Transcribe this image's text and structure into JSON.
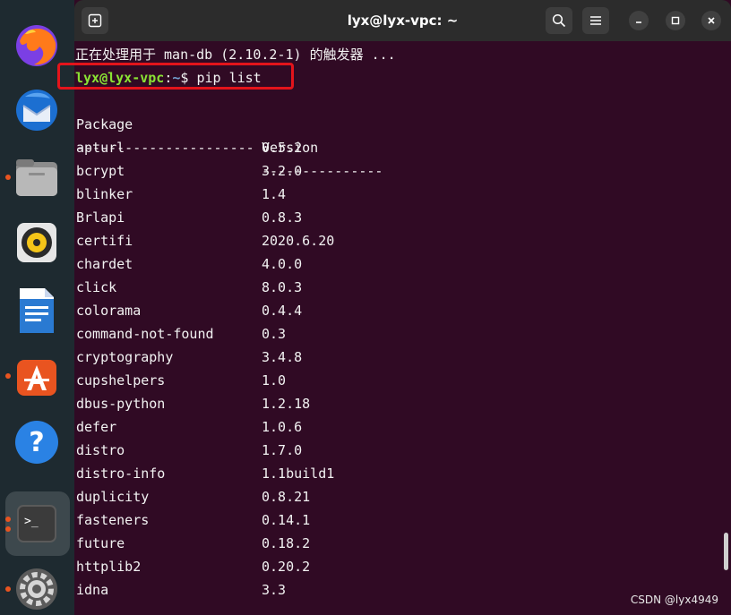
{
  "window": {
    "title": "lyx@lyx-vpc: ~"
  },
  "dock": {
    "items": [
      {
        "name": "firefox",
        "running": false
      },
      {
        "name": "thunderbird",
        "running": false
      },
      {
        "name": "files",
        "running": true
      },
      {
        "name": "rhythmbox",
        "running": false
      },
      {
        "name": "writer",
        "running": false
      },
      {
        "name": "app-center",
        "running": true
      },
      {
        "name": "help",
        "running": false
      },
      {
        "name": "terminal",
        "running": true
      },
      {
        "name": "settings",
        "running": true
      }
    ]
  },
  "terminal": {
    "status_line": "正在处理用于 man-db (2.10.2-1) 的触发器 ...",
    "prompt_user": "lyx@lyx-vpc",
    "prompt_sep": ":",
    "prompt_path": "~",
    "prompt_symbol": "$ ",
    "command": "pip list",
    "header": {
      "package": "Package",
      "version": "Version"
    },
    "separator": {
      "package": "----------------------",
      "version": "---------------"
    },
    "packages": [
      {
        "name": "apturl",
        "version": "0.5.2"
      },
      {
        "name": "bcrypt",
        "version": "3.2.0"
      },
      {
        "name": "blinker",
        "version": "1.4"
      },
      {
        "name": "Brlapi",
        "version": "0.8.3"
      },
      {
        "name": "certifi",
        "version": "2020.6.20"
      },
      {
        "name": "chardet",
        "version": "4.0.0"
      },
      {
        "name": "click",
        "version": "8.0.3"
      },
      {
        "name": "colorama",
        "version": "0.4.4"
      },
      {
        "name": "command-not-found",
        "version": "0.3"
      },
      {
        "name": "cryptography",
        "version": "3.4.8"
      },
      {
        "name": "cupshelpers",
        "version": "1.0"
      },
      {
        "name": "dbus-python",
        "version": "1.2.18"
      },
      {
        "name": "defer",
        "version": "1.0.6"
      },
      {
        "name": "distro",
        "version": "1.7.0"
      },
      {
        "name": "distro-info",
        "version": "1.1build1"
      },
      {
        "name": "duplicity",
        "version": "0.8.21"
      },
      {
        "name": "fasteners",
        "version": "0.14.1"
      },
      {
        "name": "future",
        "version": "0.18.2"
      },
      {
        "name": "httplib2",
        "version": "0.20.2"
      },
      {
        "name": "idna",
        "version": "3.3"
      }
    ]
  },
  "watermark": "CSDN @lyx4949",
  "colors": {
    "terminal_bg": "#300a24",
    "prompt_user": "#8ae234",
    "prompt_path": "#729fcf",
    "highlight_box": "#e3141b",
    "dock_accent": "#e95420"
  }
}
